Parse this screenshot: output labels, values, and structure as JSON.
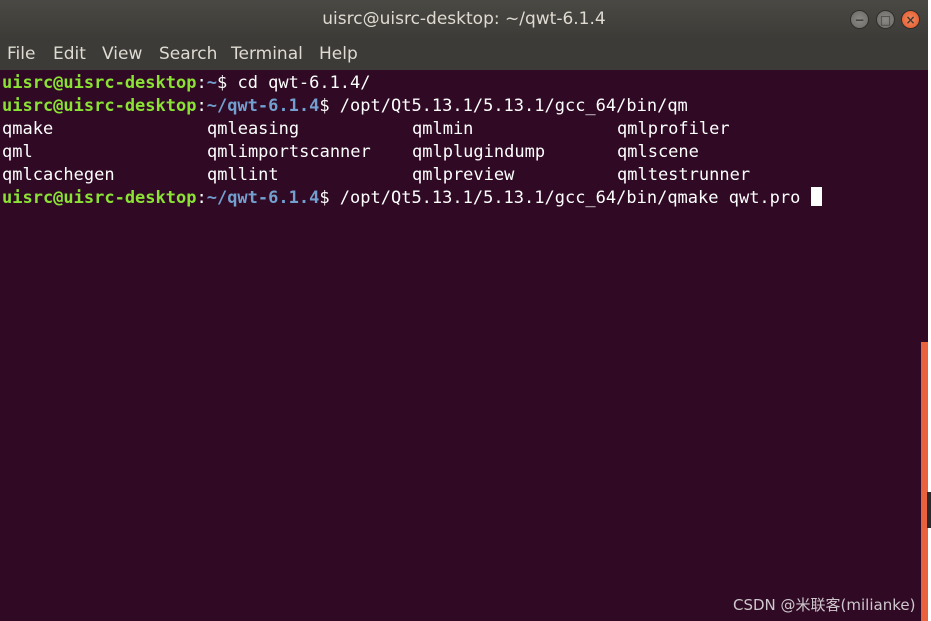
{
  "window": {
    "title": "uisrc@uisrc-desktop: ~/qwt-6.1.4",
    "buttons": {
      "minimize": "−",
      "maximize": "□",
      "close": "×"
    }
  },
  "menu": [
    "File",
    "Edit",
    "View",
    "Search",
    "Terminal",
    "Help"
  ],
  "terminal": {
    "user_host": "uisrc@uisrc-desktop",
    "line1": {
      "sep": ":",
      "path": "~",
      "prompt": "$ ",
      "cmd": "cd qwt-6.1.4/"
    },
    "line2": {
      "sep": ":",
      "path": "~/qwt-6.1.4",
      "prompt": "$ ",
      "cmd": "/opt/Qt5.13.1/5.13.1/gcc_64/bin/qm"
    },
    "completions": [
      [
        "qmake",
        "qmleasing",
        "qmlmin",
        "qmlprofiler"
      ],
      [
        "qml",
        "qmlimportscanner",
        "qmlplugindump",
        "qmlscene"
      ],
      [
        "qmlcachegen",
        "qmllint",
        "qmlpreview",
        "qmltestrunner"
      ]
    ],
    "line3": {
      "sep": ":",
      "path": "~/qwt-6.1.4",
      "prompt": "$ ",
      "cmd": "/opt/Qt5.13.1/5.13.1/gcc_64/bin/qmake qwt.pro "
    }
  },
  "colors": {
    "background": "#300a24",
    "user_host": "#8ae234",
    "path": "#729fcf",
    "text": "#ffffff",
    "scrollbar": "#e9623c"
  },
  "watermark": "CSDN @米联客(milianke)"
}
